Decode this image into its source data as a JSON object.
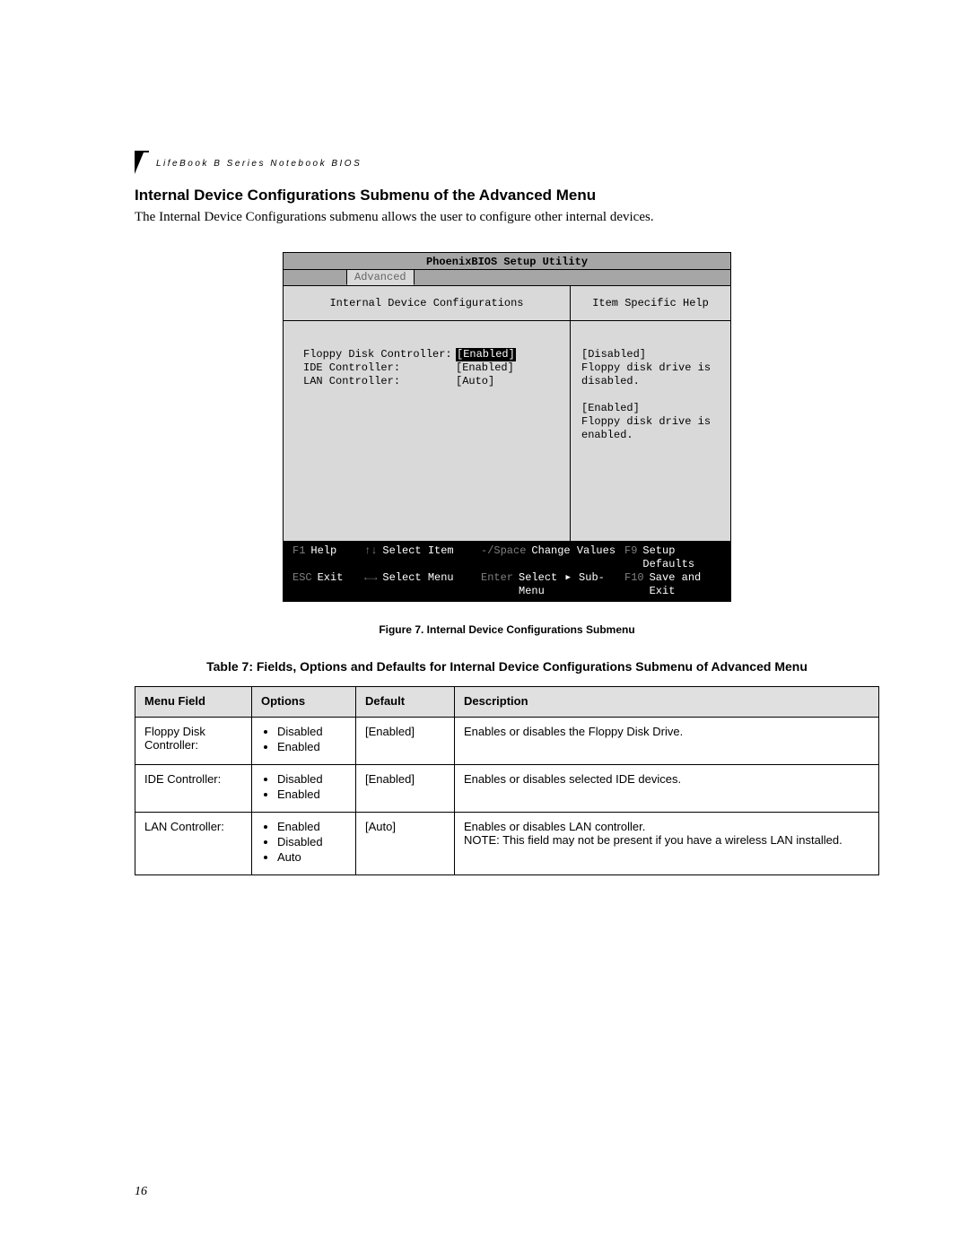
{
  "running_header": "LifeBook B Series Notebook BIOS",
  "section_title": "Internal Device Configurations Submenu of the Advanced Menu",
  "intro_text": "The Internal Device Configurations submenu allows the user to configure other internal devices.",
  "page_number": "16",
  "figure_caption": "Figure 7.  Internal Device Configurations Submenu",
  "table_title": "Table 7: Fields, Options and Defaults for Internal Device Configurations Submenu of Advanced Menu",
  "bios": {
    "title": "PhoenixBIOS Setup Utility",
    "active_tab": "Advanced",
    "panel_title_left": "Internal Device Configurations",
    "panel_title_right": "Item Specific Help",
    "settings": [
      {
        "label": "Floppy Disk Controller:",
        "value": "[Enabled]",
        "selected": true
      },
      {
        "label": "IDE Controller:",
        "value": "[Enabled]",
        "selected": false
      },
      {
        "label": "LAN Controller:",
        "value": "[Auto]",
        "selected": false
      }
    ],
    "help_text": "[Disabled]\nFloppy disk drive is disabled.\n\n[Enabled]\nFloppy disk drive is enabled.",
    "footer": [
      [
        {
          "key": "F1",
          "label": "Help"
        },
        {
          "key": "↑↓",
          "label": "Select Item"
        },
        {
          "key": "-/Space",
          "label": "Change Values"
        },
        {
          "key": "F9",
          "label": "Setup Defaults"
        }
      ],
      [
        {
          "key": "ESC",
          "label": "Exit"
        },
        {
          "key": "←→",
          "label": "Select Menu"
        },
        {
          "key": "Enter",
          "label": "Select ▶ Sub-Menu"
        },
        {
          "key": "F10",
          "label": "Save and Exit"
        }
      ]
    ]
  },
  "table": {
    "headers": [
      "Menu Field",
      "Options",
      "Default",
      "Description"
    ],
    "rows": [
      {
        "field": "Floppy Disk Controller:",
        "options": [
          "Disabled",
          "Enabled"
        ],
        "default": "[Enabled]",
        "description": "Enables or disables the Floppy Disk Drive."
      },
      {
        "field": "IDE Controller:",
        "options": [
          "Disabled",
          "Enabled"
        ],
        "default": "[Enabled]",
        "description": "Enables or disables selected IDE devices."
      },
      {
        "field": "LAN Controller:",
        "options": [
          "Enabled",
          "Disabled",
          "Auto"
        ],
        "default": "[Auto]",
        "description": "Enables or disables LAN controller.\nNOTE: This field may not be present if you have a wireless LAN installed."
      }
    ]
  }
}
